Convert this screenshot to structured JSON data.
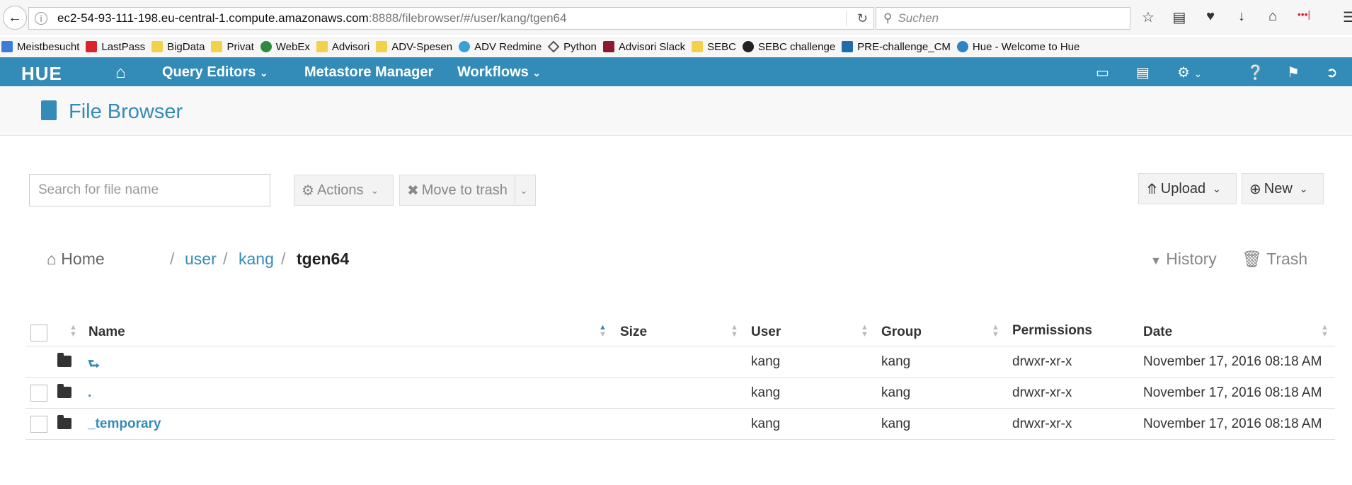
{
  "browser": {
    "url_host": "ec2-54-93-111-198.eu-central-1.compute.amazonaws.com",
    "url_path": ":8888/filebrowser/#/user/kang/tgen64",
    "search_placeholder": "Suchen",
    "bookmarks": [
      {
        "label": "Meistbesucht",
        "icon": "ms"
      },
      {
        "label": "LastPass",
        "icon": "red"
      },
      {
        "label": "BigData",
        "icon": "folder"
      },
      {
        "label": "Privat",
        "icon": "folder"
      },
      {
        "label": "WebEx",
        "icon": "globe"
      },
      {
        "label": "Advisori",
        "icon": "folder"
      },
      {
        "label": "ADV-Spesen",
        "icon": "folder"
      },
      {
        "label": "ADV Redmine",
        "icon": "gear"
      },
      {
        "label": "Python",
        "icon": "diamond"
      },
      {
        "label": "Advisori Slack",
        "icon": "slack"
      },
      {
        "label": "SEBC",
        "icon": "folder"
      },
      {
        "label": "SEBC challenge",
        "icon": "gh"
      },
      {
        "label": "PRE-challenge_CM",
        "icon": "c"
      },
      {
        "label": "Hue - Welcome to Hue",
        "icon": "hue"
      }
    ]
  },
  "nav": {
    "logo": "HUE",
    "query_editors": "Query Editors",
    "metastore": "Metastore Manager",
    "workflows": "Workflows"
  },
  "page": {
    "title": "File Browser"
  },
  "toolbar": {
    "search_placeholder": "Search for file name",
    "actions": "Actions",
    "move_to_trash": "Move to trash",
    "upload": "Upload",
    "new": "New"
  },
  "breadcrumb": {
    "home": "Home",
    "user": "user",
    "kang": "kang",
    "current": "tgen64",
    "history": "History",
    "trash": "Trash"
  },
  "table": {
    "headers": {
      "name": "Name",
      "size": "Size",
      "user": "User",
      "group": "Group",
      "permissions": "Permissions",
      "date": "Date"
    },
    "rows": [
      {
        "name": "⮑",
        "user": "kang",
        "group": "kang",
        "permissions": "drwxr-xr-x",
        "date": "November 17, 2016 08:18 AM"
      },
      {
        "name": ".",
        "user": "kang",
        "group": "kang",
        "permissions": "drwxr-xr-x",
        "date": "November 17, 2016 08:18 AM"
      },
      {
        "name": "_temporary",
        "user": "kang",
        "group": "kang",
        "permissions": "drwxr-xr-x",
        "date": "November 17, 2016 08:18 AM"
      }
    ]
  },
  "colors": {
    "hue_blue": "#338bb8",
    "nav_bg": "#338bb8"
  }
}
